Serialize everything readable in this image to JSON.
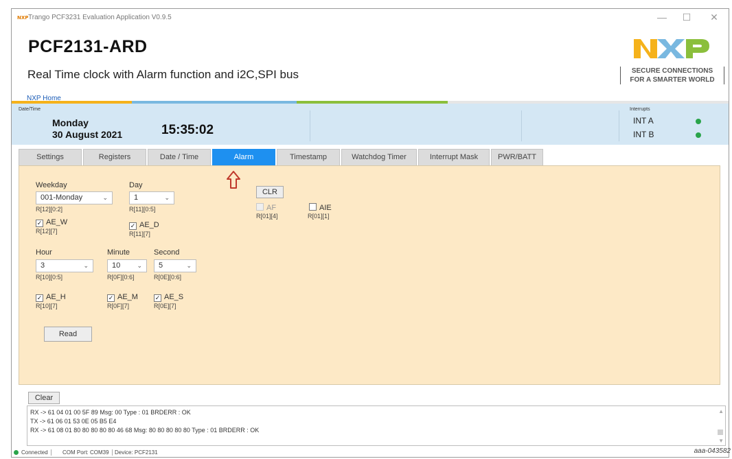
{
  "window": {
    "title": "Trango PCF3231 Evaluation Application V0.9.5",
    "app_icon_text": "NXP",
    "controls": [
      "—",
      "☐",
      "✕"
    ]
  },
  "header": {
    "title": "PCF2131-ARD",
    "subtitle": "Real Time clock with Alarm function and i2C,SPI bus",
    "home_link": "NXP Home",
    "logo_text": "NXP",
    "tagline_line1": "SECURE CONNECTIONS",
    "tagline_line2": "FOR A SMARTER WORLD",
    "color_stripe": [
      "#f5b21b",
      "#8bbf3c",
      "#79b8e0",
      "#e6e6e6"
    ]
  },
  "datetime": {
    "label": "Date/Time",
    "weekday": "Monday",
    "date": "30 August 2021",
    "time": "15:35:02"
  },
  "interrupts": {
    "label": "Interrupts",
    "items": [
      {
        "name": "INT A",
        "color": "#2aa44a"
      },
      {
        "name": "INT B",
        "color": "#2aa44a"
      }
    ]
  },
  "tabs": [
    {
      "label": "Settings",
      "active": false
    },
    {
      "label": "Registers",
      "active": false
    },
    {
      "label": "Date / Time",
      "active": false
    },
    {
      "label": "Alarm",
      "active": true
    },
    {
      "label": "Timestamp",
      "active": false
    },
    {
      "label": "Watchdog Timer",
      "active": false
    },
    {
      "label": "Interrupt Mask",
      "active": false
    },
    {
      "label": "PWR/BATT",
      "active": false
    }
  ],
  "accent_color": "#1e90f0",
  "annotation_arrow_color": "#c0392b",
  "alarm": {
    "weekday_label": "Weekday",
    "weekday_value": "001-Monday",
    "weekday_reg": "R[12][0:2]",
    "day_label": "Day",
    "day_value": "1",
    "day_reg": "R[11][0:5]",
    "ae_w_label": "AE_W",
    "ae_w_reg": "R[12][7]",
    "ae_d_label": "AE_D",
    "ae_d_reg": "R[11][7]",
    "hour_label": "Hour",
    "hour_value": "3",
    "hour_reg": "R[10][0:5]",
    "minute_label": "Minute",
    "minute_value": "10",
    "minute_reg": "R[0F][0:6]",
    "second_label": "Second",
    "second_value": "5",
    "second_reg": "R[0E][0:6]",
    "ae_h_label": "AE_H",
    "ae_h_reg": "R[10][7]",
    "ae_m_label": "AE_M",
    "ae_m_reg": "R[0F][7]",
    "ae_s_label": "AE_S",
    "ae_s_reg": "R[0E][7]",
    "read_button": "Read",
    "clr_button": "CLR",
    "af_label": "AF",
    "af_reg": "R[01][4]",
    "aie_label": "AIE",
    "aie_reg": "R[01][1]",
    "check_mark": "✓",
    "chevron": "⌄"
  },
  "log": {
    "clear_button": "Clear Log",
    "lines": [
      "RX -> 61 04 01 00 5F 89  Msg: 00  Type : 01 BRDERR : OK",
      "TX -> 61 06 01 53 0E 05 B5 E4",
      "RX -> 61 08 01 80 80 80 80 80 46 68  Msg: 80 80 80 80 80  Type : 01 BRDERR : OK"
    ]
  },
  "status": {
    "connection": "Connected",
    "com_port": "COM Port: COM39",
    "device": "Device: PCF2131"
  },
  "figure_id": "aaa-043582"
}
